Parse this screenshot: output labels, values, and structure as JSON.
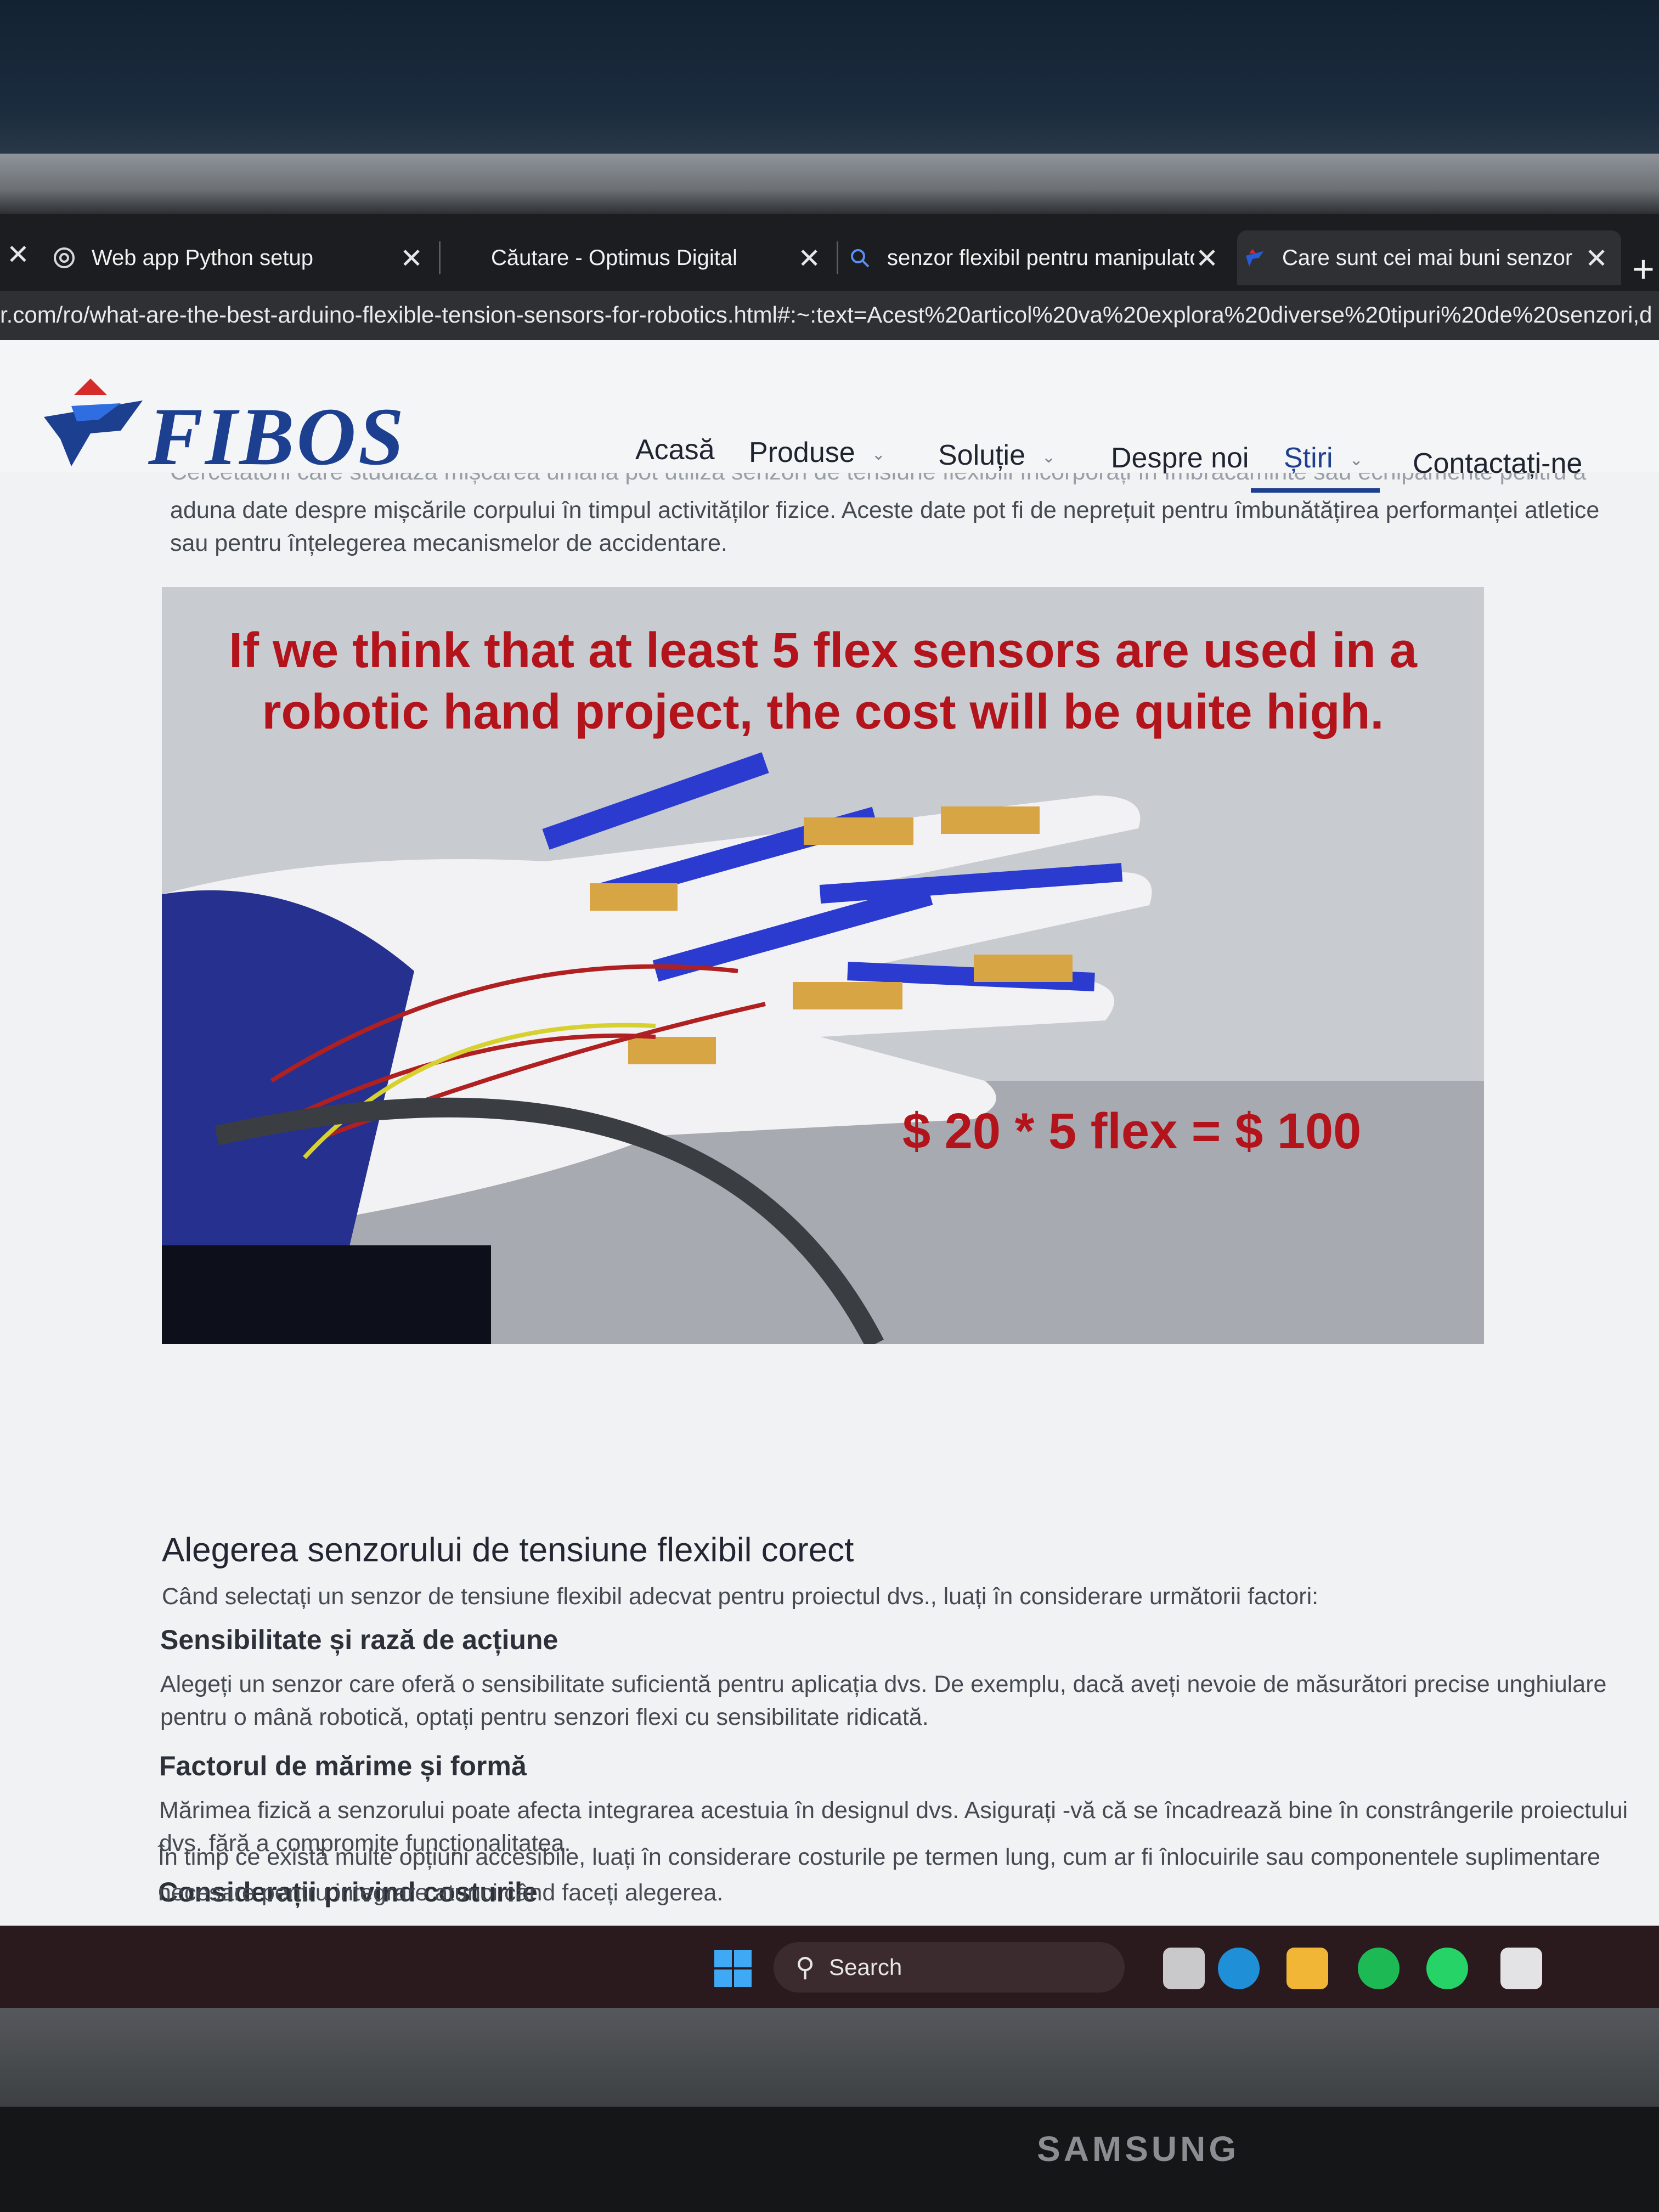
{
  "browser": {
    "tabs": [
      {
        "title": "Web app Python setup"
      },
      {
        "title": "Căutare - Optimus Digital"
      },
      {
        "title": "senzor flexibil pentru manipulato"
      },
      {
        "title": "Care sunt cei mai buni senzori de"
      }
    ],
    "url": "r.com/ro/what-are-the-best-arduino-flexible-tension-sensors-for-robotics.html#:~:text=Acest%20articol%20va%20explora%20diverse%20tipuri%20de%20senzori,d"
  },
  "site": {
    "logo_text": "FIBOS",
    "nav": [
      "Acasă",
      "Produse",
      "Soluție",
      "Despre noi",
      "Știri",
      "Contactați-ne"
    ],
    "active_nav": "Știri"
  },
  "article": {
    "intro_cut": "Cercetătorii care studiază mișcarea umană pot utiliza senzori de tensiune flexibili încorporați în îmbrăcăminte sau echipamente pentru a",
    "intro_line2": "aduna date despre mișcările corpului în timpul activităților fizice. Aceste date pot fi de neprețuit pentru îmbunătățirea performanței atletice",
    "intro_line3": "sau pentru înțelegerea mecanismelor de accidentare.",
    "figure_caption_1": "If we think that at least 5 flex sensors are used in a",
    "figure_caption_2": "robotic hand project, the cost will be quite high.",
    "figure_formula": "$ 20 * 5 flex  =  $ 100",
    "section_title": "Alegerea senzorului de tensiune flexibil corect",
    "section_intro": "Când selectați un senzor de tensiune flexibil adecvat pentru proiectul dvs., luați în considerare următorii factori:",
    "subsections": [
      {
        "title": "Sensibilitate și rază de acțiune",
        "line1": "Alegeți un senzor care oferă o sensibilitate suficientă pentru aplicația dvs. De exemplu, dacă aveți nevoie de măsurători precise unghiulare",
        "line2": "pentru o mână robotică, optați pentru senzori flexi cu sensibilitate ridicată."
      },
      {
        "title": "Factorul de mărime și formă",
        "line1": "Mărimea fizică a senzorului poate afecta integrarea acestuia în designul dvs. Asigurați -vă că se încadrează bine în constrângerile proiectului",
        "line2": "dvs. fără a compromite funcționalitatea."
      },
      {
        "title": "Considerații privind costurile",
        "line1": "În timp ce există multe opțiuni accesibile, luați în considerare costurile pe termen lung, cum ar fi înlocuirile sau componentele suplimentare",
        "line2": "necesare pentru integrare atunci când faceți alegerea."
      }
    ]
  },
  "taskbar": {
    "search_label": "Search"
  },
  "monitor": {
    "brand": "SAMSUNG"
  },
  "colors": {
    "brand_blue": "#1c3f8f",
    "caption_red": "#b3131b",
    "tab_bg": "#1c1d20"
  }
}
